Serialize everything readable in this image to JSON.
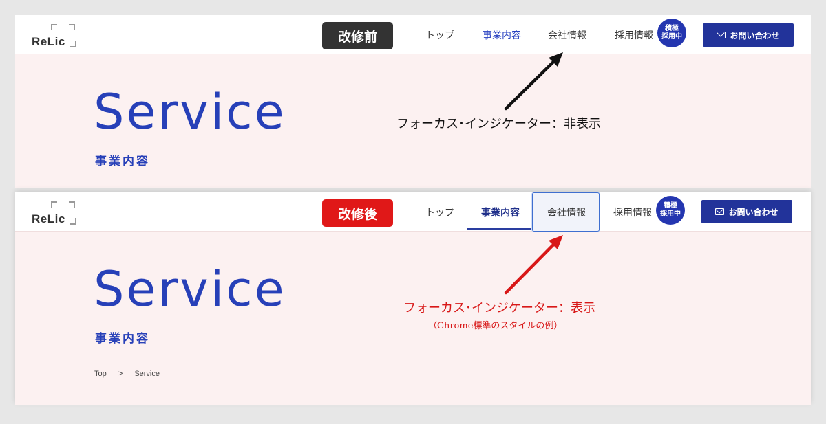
{
  "site": {
    "logo_text": "ReLic"
  },
  "before": {
    "stamp": "改修前",
    "nav": [
      "トップ",
      "事業内容",
      "会社情報",
      "採用情報"
    ],
    "badge": [
      "積極",
      "採用中"
    ],
    "contact": "お問い合わせ",
    "hero_title": "Service",
    "hero_sub": "事業内容",
    "annotation": "フォーカス･インジケーター：非表示"
  },
  "after": {
    "stamp": "改修後",
    "nav": [
      "トップ",
      "事業内容",
      "会社情報",
      "採用情報"
    ],
    "badge": [
      "積極",
      "採用中"
    ],
    "contact": "お問い合わせ",
    "hero_title": "Service",
    "hero_sub": "事業内容",
    "breadcrumb": [
      "Top",
      ">",
      "Service"
    ],
    "annotation": "フォーカス･インジケーター：表示",
    "annotation_note": "（Chrome標準のスタイルの例）"
  },
  "colors": {
    "brand_blue": "#2740b8",
    "before_stamp": "#333333",
    "after_stamp": "#e01818",
    "focus_outline": "#3f6fd0",
    "hero_bg": "#fcf1f1"
  },
  "icons": [
    "mail-icon",
    "arrow-icon"
  ]
}
